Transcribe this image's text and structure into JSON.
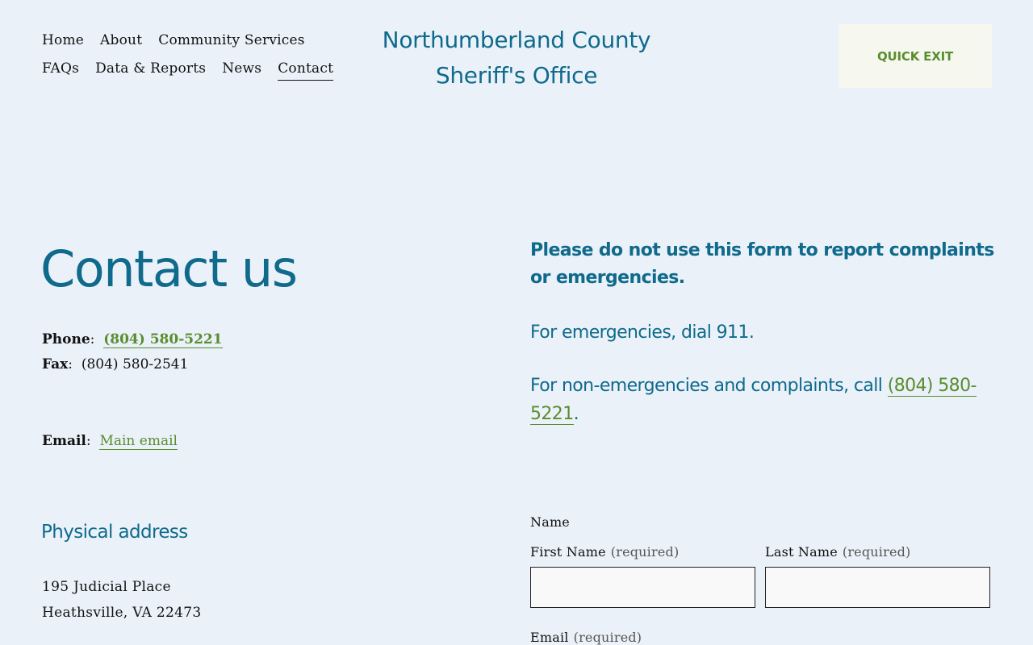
{
  "nav": {
    "items": [
      {
        "label": "Home"
      },
      {
        "label": "About"
      },
      {
        "label": "Community Services"
      },
      {
        "label": "FAQs"
      },
      {
        "label": "Data & Reports"
      },
      {
        "label": "News"
      },
      {
        "label": "Contact",
        "active": true
      }
    ]
  },
  "site": {
    "title_line1": "Northumberland County",
    "title_line2": "Sheriff's Office"
  },
  "quick_exit": {
    "label": "QUICK EXIT"
  },
  "contact": {
    "heading": "Contact us",
    "phone_label": "Phone",
    "phone_value": "(804) 580-5221",
    "fax_label": "Fax",
    "fax_value": "(804) 580-2541",
    "email_label": "Email",
    "email_link": "Main email"
  },
  "address": {
    "heading": "Physical address",
    "line1": "195 Judicial Place",
    "line2": "Heathsville, VA 22473"
  },
  "notice": {
    "warning": "Please do not use this form to report complaints or emergencies.",
    "emergency": "For emergencies, dial 911.",
    "nonemergency_prefix": "For non-emergencies and complaints, call ",
    "nonemergency_phone": "(804) 580-5221",
    "nonemergency_suffix": "."
  },
  "form": {
    "name_label": "Name",
    "first_name_label": "First Name",
    "last_name_label": "Last Name",
    "email_label": "Email",
    "required_text": "(required)"
  },
  "colors": {
    "background": "#eaf1f9",
    "heading_blue": "#0f6a8b",
    "link_green": "#5a8d2e",
    "quick_exit_bg": "#f6f8ef"
  }
}
